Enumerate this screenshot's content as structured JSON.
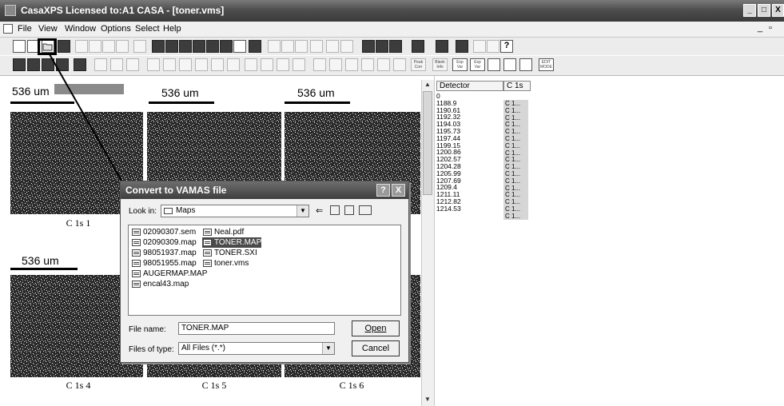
{
  "window": {
    "title": "CasaXPS Licensed to:A1 CASA - [toner.vms]"
  },
  "menu": [
    "File",
    "View",
    "Window",
    "Options",
    "Select",
    "Help"
  ],
  "map": {
    "scale_label": "536 um",
    "panels": [
      {
        "label": "C 1s 1"
      },
      {
        "label": ""
      },
      {
        "label": ""
      },
      {
        "label": "C 1s 4"
      },
      {
        "label": "C 1s 5"
      },
      {
        "label": "C 1s 6"
      }
    ]
  },
  "table": {
    "headers": [
      "Detector",
      "C 1s"
    ],
    "rows": [
      "0",
      "1188.9",
      "1190.61",
      "1192.32",
      "1194.03",
      "1195.73",
      "1197.44",
      "1199.15",
      "1200.86",
      "1202.57",
      "1204.28",
      "1205.99",
      "1207.69",
      "1209.4",
      "1211.11",
      "1212.82",
      "1214.53"
    ],
    "cell_value": "C 1..."
  },
  "dialog": {
    "title": "Convert to VAMAS file",
    "look_in_label": "Look in:",
    "look_in_value": "Maps",
    "files_col1": [
      "02090307.sem",
      "02090309.map",
      "98051937.map",
      "98051955.map",
      "AUGERMAP.MAP",
      "encal43.map"
    ],
    "files_col2": [
      "Neal.pdf",
      "TONER.MAP",
      "TONER.SXI",
      "toner.vms"
    ],
    "selected_file": "TONER.MAP",
    "file_name_label": "File name:",
    "file_name_value": "TONER.MAP",
    "file_type_label": "Files of type:",
    "file_type_value": "All Files (*.*)",
    "open_label": "Open",
    "cancel_label": "Cancel",
    "help_glyph": "?",
    "close_glyph": "X"
  },
  "toolbar": {
    "peak_label": "Peak Corr",
    "blank_label": "Blank Info",
    "exp_vs_label": "Exp Var",
    "exp_vs2_label": "Exp Var",
    "edit_mode_label": "EDIT MODE"
  }
}
